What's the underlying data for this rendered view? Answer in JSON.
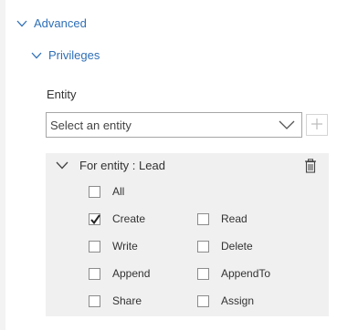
{
  "sections": {
    "advanced": {
      "label": "Advanced",
      "expanded": true
    },
    "privileges": {
      "label": "Privileges",
      "expanded": true
    }
  },
  "entity": {
    "label": "Entity",
    "placeholder": "Select an entity",
    "add_icon": "plus-icon",
    "dropdown_icon": "chevron-down-icon"
  },
  "panel": {
    "title": "For entity : Lead",
    "expanded": true,
    "delete_icon": "trash-icon",
    "checkboxes": {
      "all": {
        "label": "All",
        "checked": false
      },
      "create": {
        "label": "Create",
        "checked": true
      },
      "read": {
        "label": "Read",
        "checked": false
      },
      "write": {
        "label": "Write",
        "checked": false
      },
      "delete": {
        "label": "Delete",
        "checked": false
      },
      "append": {
        "label": "Append",
        "checked": false
      },
      "appendto": {
        "label": "AppendTo",
        "checked": false
      },
      "share": {
        "label": "Share",
        "checked": false
      },
      "assign": {
        "label": "Assign",
        "checked": false
      }
    }
  },
  "colors": {
    "link": "#2f6fb6",
    "panel_bg": "#f0f0f0",
    "border": "#a6a6a6"
  }
}
